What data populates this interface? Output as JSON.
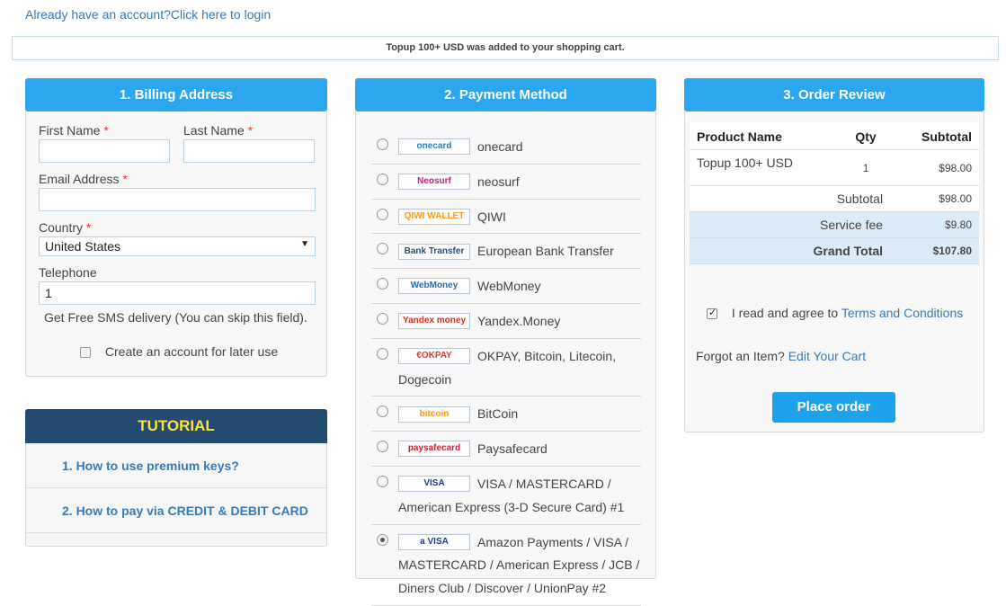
{
  "login_link": "Already have an account?Click here to login",
  "cart_notice": "Topup 100+ USD was added to your shopping cart.",
  "billing": {
    "title": "1. Billing Address",
    "first_name_label": "First Name",
    "last_name_label": "Last Name",
    "email_label": "Email Address",
    "country_label": "Country",
    "country_value": "United States",
    "telephone_label": "Telephone",
    "telephone_value": "1",
    "sms_note": "Get Free SMS delivery (You can skip this field).",
    "create_account_label": "Create an account for later use",
    "required_mark": "*",
    "caret": "▼"
  },
  "tutorial": {
    "title": "TUTORIAL",
    "items": [
      "1. How to use premium keys?",
      "2. How to pay via CREDIT & DEBIT CARD"
    ]
  },
  "payment": {
    "title": "2. Payment Method",
    "methods": [
      {
        "logo": "onecard",
        "name": "onecard",
        "logo_color": "#2a7fc0"
      },
      {
        "logo": "Neosurf",
        "name": "neosurf",
        "logo_color": "#e0157a"
      },
      {
        "logo": "QIWI WALLET",
        "name": "QIWI",
        "logo_color": "#f79a1e"
      },
      {
        "logo": "Bank Transfer",
        "name": "European Bank Transfer",
        "logo_color": "#1f4f8a"
      },
      {
        "logo": "WebMoney",
        "name": "WebMoney",
        "logo_color": "#2a6bb0"
      },
      {
        "logo": "Yandex money",
        "name": "Yandex.Money",
        "logo_color": "#d2301c"
      },
      {
        "logo": "€OKPAY",
        "name": "OKPAY, Bitcoin, Litecoin, Dogecoin",
        "logo_color": "#e9372c"
      },
      {
        "logo": "bitcoin",
        "name": "BitCoin",
        "logo_color": "#f7931a"
      },
      {
        "logo": "paysafecard",
        "name": "Paysafecard",
        "logo_color": "#d1203c"
      },
      {
        "logo": "VISA",
        "name": "VISA / MASTERCARD / American Express (3-D Secure Card) #1",
        "logo_color": "#1a3a8c"
      },
      {
        "logo": "a VISA",
        "name": "Amazon Payments / VISA / MASTERCARD / American Express / JCB / Diners Club / Discover / UnionPay #2",
        "logo_color": "#1a3a8c"
      }
    ],
    "selected_index": 10
  },
  "review": {
    "title": "3. Order Review",
    "col_product": "Product Name",
    "col_qty": "Qty",
    "col_subtotal": "Subtotal",
    "product_name": "Topup 100+ USD",
    "product_qty": "1",
    "product_subtotal": "$98.00",
    "subtotal_label": "Subtotal",
    "subtotal_value": "$98.00",
    "service_fee_label": "Service fee",
    "service_fee_value": "$9.80",
    "grand_total_label": "Grand Total",
    "grand_total_value": "$107.80",
    "agree_prefix": "I read and agree to",
    "terms_link": "Terms and Conditions",
    "forgot_prefix": "Forgot an Item?",
    "edit_cart_link": "Edit Your Cart",
    "place_order": "Place order"
  }
}
